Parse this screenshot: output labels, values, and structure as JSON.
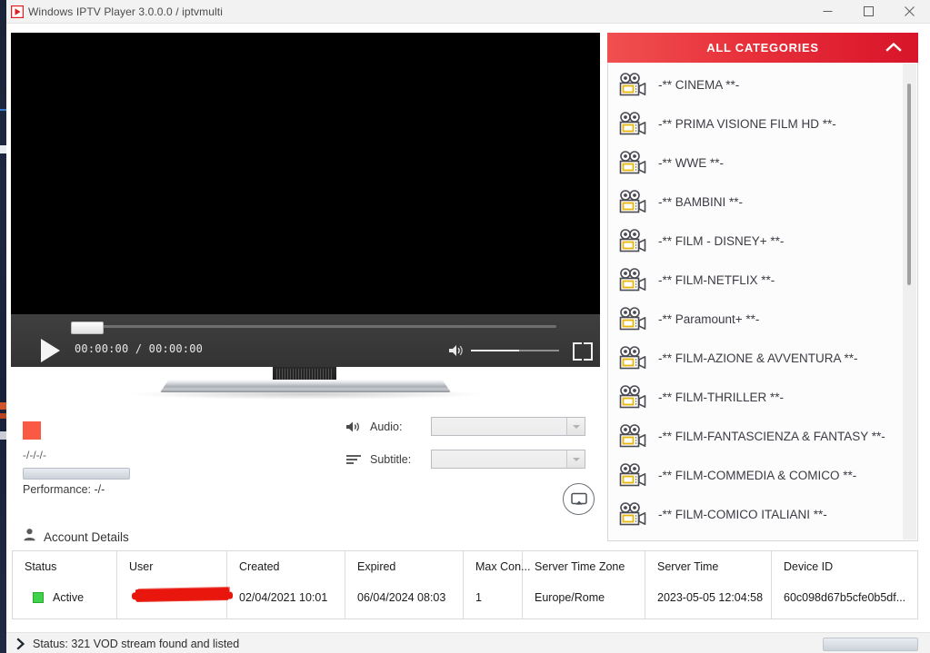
{
  "window": {
    "title": "Windows IPTV Player 3.0.0.0 / iptvmulti",
    "app_icon": "play-triangle-icon",
    "controls": {
      "minimize": "minimize-icon",
      "maximize": "maximize-icon",
      "close": "close-icon"
    }
  },
  "player": {
    "play_icon": "play-icon",
    "timecode": "00:00:00 / 00:00:00",
    "volume_icon": "volume-icon",
    "fullscreen_icon": "fullscreen-icon",
    "seek_position_percent": 0,
    "volume_percent": 55
  },
  "info": {
    "resolution_label": "-/-/-/-",
    "performance_label": "Performance: -/-",
    "indicator_color": "#fa5a44"
  },
  "media_options": {
    "audio_label": "Audio:",
    "audio_value": "",
    "audio_icon": "speaker-icon",
    "subtitle_label": "Subtitle:",
    "subtitle_value": "",
    "subtitle_icon": "subtitle-lines-icon",
    "cast_icon": "cast-screen-icon"
  },
  "account": {
    "section_title": "Account Details",
    "section_icon": "user-icon",
    "columns": [
      "Status",
      "User",
      "Created",
      "Expired",
      "Max Con...",
      "Server Time Zone",
      "Server Time",
      "Device ID"
    ],
    "row": {
      "status": "Active",
      "status_color": "#3fd24a",
      "user": "",
      "created": "02/04/2021 10:01",
      "expired": "06/04/2024 08:03",
      "max_connections": "1",
      "server_time_zone": "Europe/Rome",
      "server_time": "2023-05-05 12:04:58",
      "device_id": "60c098d67b5cfe0b5df..."
    }
  },
  "categories_panel": {
    "header": "ALL CATEGORIES",
    "header_accent": "#e8303a",
    "collapse_icon": "chevron-up-icon",
    "item_icon": "movie-camera-icon",
    "items": [
      {
        "label": "-** CINEMA **-"
      },
      {
        "label": "-** PRIMA VISIONE FILM HD **-"
      },
      {
        "label": "-** WWE **-"
      },
      {
        "label": "-** BAMBINI **-"
      },
      {
        "label": "-** FILM - DISNEY+ **-"
      },
      {
        "label": "-** FILM-NETFLIX **-"
      },
      {
        "label": "-** Paramount+ **-"
      },
      {
        "label": "-** FILM-AZIONE & AVVENTURA **-"
      },
      {
        "label": "-** FILM-THRILLER **-"
      },
      {
        "label": "-** FILM-FANTASCIENZA & FANTASY **-"
      },
      {
        "label": "-** FILM-COMMEDIA & COMICO **-"
      },
      {
        "label": "-** FILM-COMICO ITALIANI **-"
      }
    ]
  },
  "statusbar": {
    "icon": "chevron-right-icon",
    "text": "Status: 321 VOD stream found and listed"
  }
}
